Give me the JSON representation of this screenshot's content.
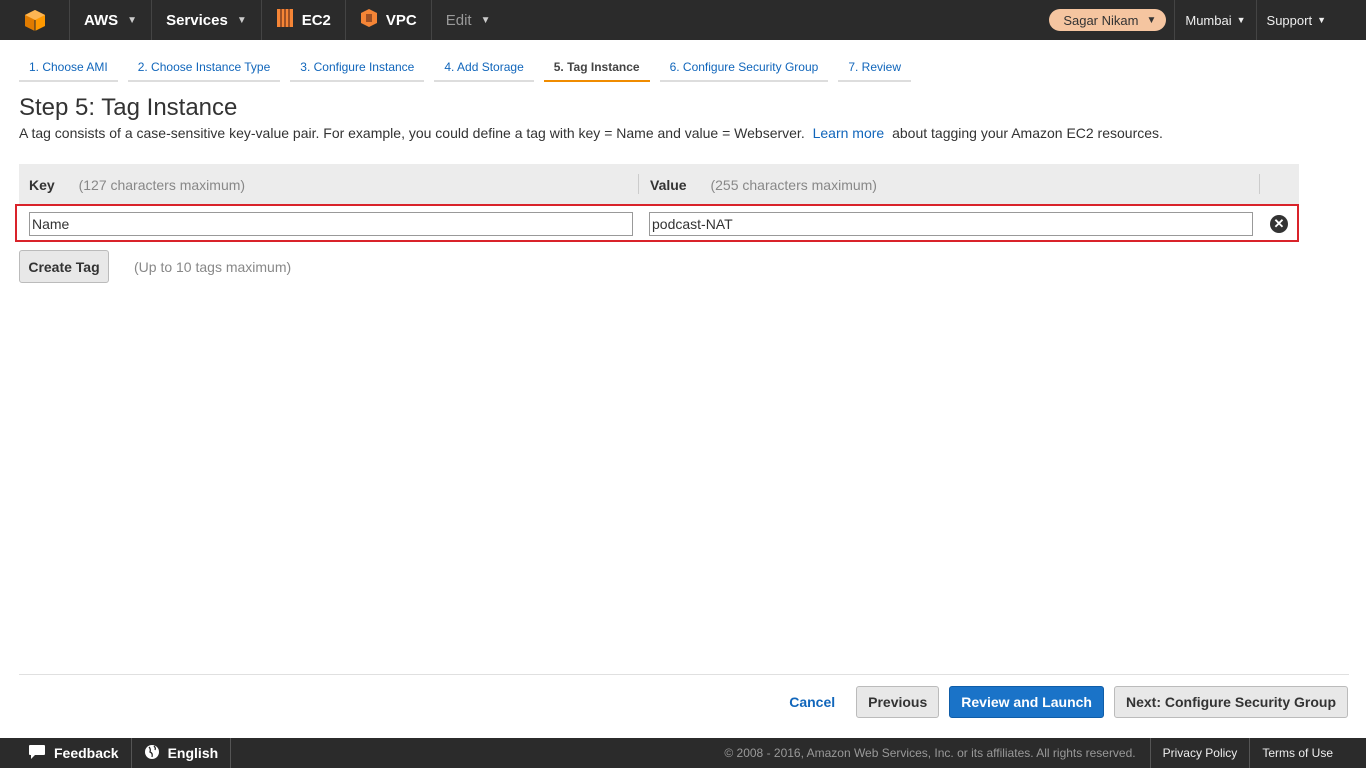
{
  "topnav": {
    "logo_icon": "aws-cube-icon",
    "aws_label": "AWS",
    "services_label": "Services",
    "ec2_label": "EC2",
    "vpc_label": "VPC",
    "edit_label": "Edit",
    "user_label": "Sagar Nikam",
    "region_label": "Mumbai",
    "support_label": "Support"
  },
  "steps": [
    {
      "label": "1. Choose AMI"
    },
    {
      "label": "2. Choose Instance Type"
    },
    {
      "label": "3. Configure Instance"
    },
    {
      "label": "4. Add Storage"
    },
    {
      "label": "5. Tag Instance"
    },
    {
      "label": "6. Configure Security Group"
    },
    {
      "label": "7. Review"
    }
  ],
  "page": {
    "title": "Step 5: Tag Instance",
    "desc_before": "A tag consists of a case-sensitive key-value pair. For example, you could define a tag with key = Name and value = Webserver.",
    "learn_more": "Learn more",
    "desc_after": "about tagging your Amazon EC2 resources."
  },
  "table": {
    "key_header": "Key",
    "key_hint": "(127 characters maximum)",
    "value_header": "Value",
    "value_hint": "(255 characters maximum)",
    "row": {
      "key": "Name",
      "value": "podcast-NAT"
    }
  },
  "create_tag_label": "Create Tag",
  "tags_max_hint": "(Up to 10 tags maximum)",
  "actions": {
    "cancel": "Cancel",
    "previous": "Previous",
    "review_launch": "Review and Launch",
    "next": "Next: Configure Security Group"
  },
  "footer": {
    "feedback": "Feedback",
    "language": "English",
    "copyright": "© 2008 - 2016, Amazon Web Services, Inc. or its affiliates. All rights reserved.",
    "privacy": "Privacy Policy",
    "terms": "Terms of Use"
  },
  "colors": {
    "active_tab_accent": "#f08c00",
    "highlight_border": "#d9232a",
    "primary_button": "#1a73c8"
  }
}
